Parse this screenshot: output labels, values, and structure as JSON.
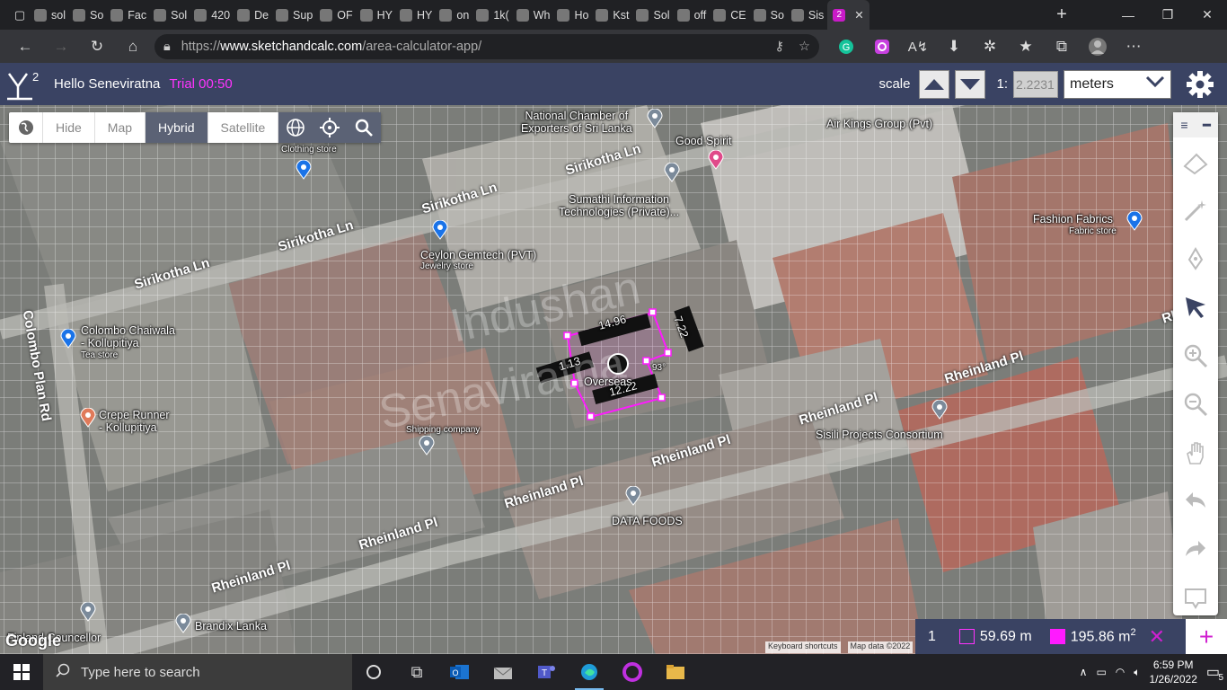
{
  "browser": {
    "tabs": [
      {
        "label": "sol"
      },
      {
        "label": "So"
      },
      {
        "label": "Fac"
      },
      {
        "label": "Sol"
      },
      {
        "label": "420"
      },
      {
        "label": "De"
      },
      {
        "label": "Sup"
      },
      {
        "label": "OF"
      },
      {
        "label": "HY"
      },
      {
        "label": "HY"
      },
      {
        "label": "on"
      },
      {
        "label": "1k("
      },
      {
        "label": "Wh"
      },
      {
        "label": "Ho"
      },
      {
        "label": "Kst"
      },
      {
        "label": "Sol"
      },
      {
        "label": "off"
      },
      {
        "label": "CE"
      },
      {
        "label": "So"
      },
      {
        "label": "Sis"
      },
      {
        "label": "2",
        "active": true
      }
    ],
    "url_prefix": "https://",
    "url_host": "www.sketchandcalc.com",
    "url_path": "/area-calculator-app/"
  },
  "app": {
    "greeting": "Hello Seneviratna",
    "trial": "Trial 00:50",
    "scale_label": "scale",
    "ratio_label": "1:",
    "scale_value": "2.2231",
    "unit": "meters",
    "accent": "#ff33ff",
    "header_bg": "#3a4363"
  },
  "map_toolbar": {
    "hide": "Hide",
    "map": "Map",
    "hybrid": "Hybrid",
    "satellite": "Satellite"
  },
  "map_labels": {
    "national_chamber_1": "National Chamber of",
    "national_chamber_2": "Exporters of Sri Lanka",
    "good_spirit": "Good Spirit",
    "air_kings": "Air Kings Group (Pvt)",
    "clothing_store": "Clothing store",
    "sumathi_1": "Sumathi Information",
    "sumathi_2": "Technologies (Private)...",
    "fashion_fabrics": "Fashion Fabrics",
    "fabric_store": "Fabric store",
    "ceylon_gemtech": "Ceylon Gemtech (PVT)",
    "jewelry_store": "Jewelry store",
    "colombo_chaiwala_1": "Colombo Chaiwala",
    "colombo_chaiwala_2": "- Kollupitiya",
    "tea_store": "Tea store",
    "crepe_runner_1": "Crepe Runner",
    "crepe_runner_2": "- Kollupitiya",
    "shipping_company": "Shipping company",
    "sisili": "Sisili Projects Consortium",
    "data_foods": "DATA FOODS",
    "brandix": "Brandix Lanka",
    "finland": "Finland Councellor",
    "overseas": "Overseas",
    "roads": {
      "sirikotha_1": "Sirikotha Ln",
      "sirikotha_2": "Sirikotha Ln",
      "sirikotha_3": "Sirikotha Ln",
      "sirikotha_4": "Sirikotha Ln",
      "colombo_plan": "Colombo Plan Rd",
      "rheinland_1": "Rheinland Pl",
      "rheinland_2": "Rheinland Pl",
      "rheinland_3": "Rheinland Pl",
      "rheinland_4": "Rheinland Pl",
      "rheinland_5": "Rheinland Pl",
      "rheinland_6": "Rheinland Pl",
      "rheinland_7": "Rheinland Pl",
      "rheinland_8": "Rh"
    },
    "watermark_1": "Indushan",
    "watermark_2": "Senaviratna",
    "google": "Google",
    "keyboard_shortcuts": "Keyboard shortcuts",
    "map_data": "Map data ©2022"
  },
  "shape": {
    "top_edge": "14.96",
    "right_edge": "7.22",
    "left_edge": "1.13",
    "bottom_edge": "12.22",
    "angle": "93°"
  },
  "dimensions": {
    "index": "1",
    "perimeter": "59.69 m",
    "area": "195.86 m",
    "area_sup": "2",
    "close": "✕",
    "add": "+"
  },
  "taskbar": {
    "search_placeholder": "Type here to search",
    "time": "6:59 PM",
    "date": "1/26/2022",
    "notifications": "5"
  }
}
